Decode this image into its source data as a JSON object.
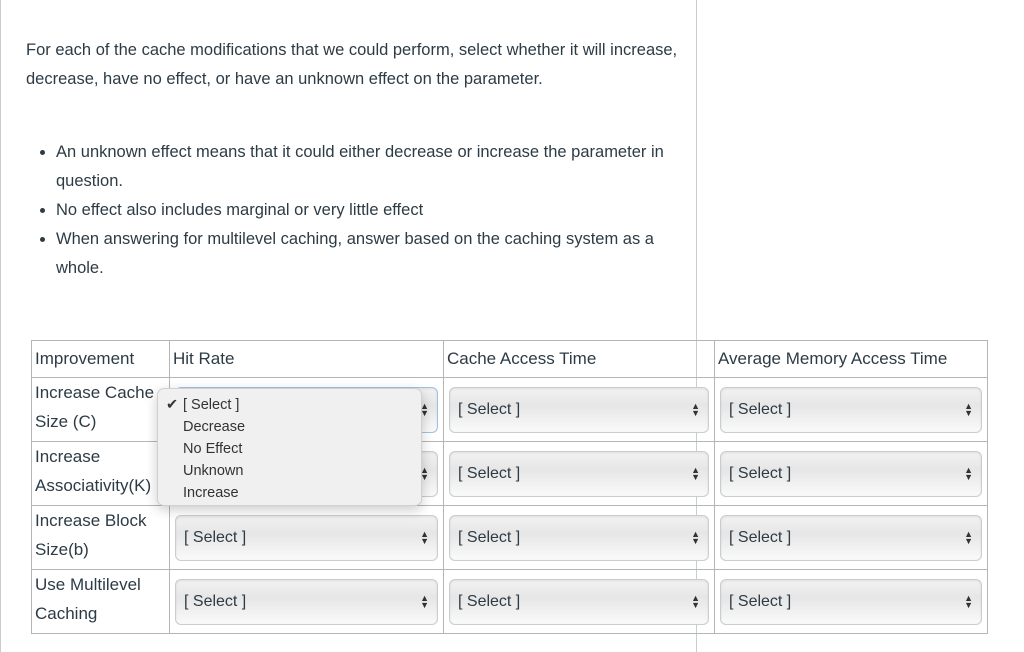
{
  "intro": "For each of the cache modifications that we could perform, select whether it will increase, decrease, have no effect, or have an unknown effect on the parameter.",
  "bullets": [
    "An unknown effect means that it could either decrease or increase the parameter in question.",
    "No effect also includes marginal or very little effect",
    "When answering for multilevel caching, answer based on the caching system as a whole."
  ],
  "table": {
    "headers": [
      "Improvement",
      "Hit Rate",
      "Cache Access Time",
      "Average Memory Access Time"
    ],
    "rows": [
      {
        "label": "Increase Cache Size (C)",
        "values": [
          "[ Select ]",
          "[ Select ]",
          "[ Select ]"
        ]
      },
      {
        "label": "Increase Associativity(K)",
        "values": [
          "[ Select ]",
          "[ Select ]",
          "[ Select ]"
        ]
      },
      {
        "label": "Increase Block Size(b)",
        "values": [
          "[ Select ]",
          "[ Select ]",
          "[ Select ]"
        ]
      },
      {
        "label": "Use Multilevel Caching",
        "values": [
          "[ Select ]",
          "[ Select ]",
          "[ Select ]"
        ]
      }
    ]
  },
  "dropdown": {
    "selected": "[ Select ]",
    "options": [
      "[ Select ]",
      "Decrease",
      "No Effect",
      "Unknown",
      "Increase"
    ]
  }
}
